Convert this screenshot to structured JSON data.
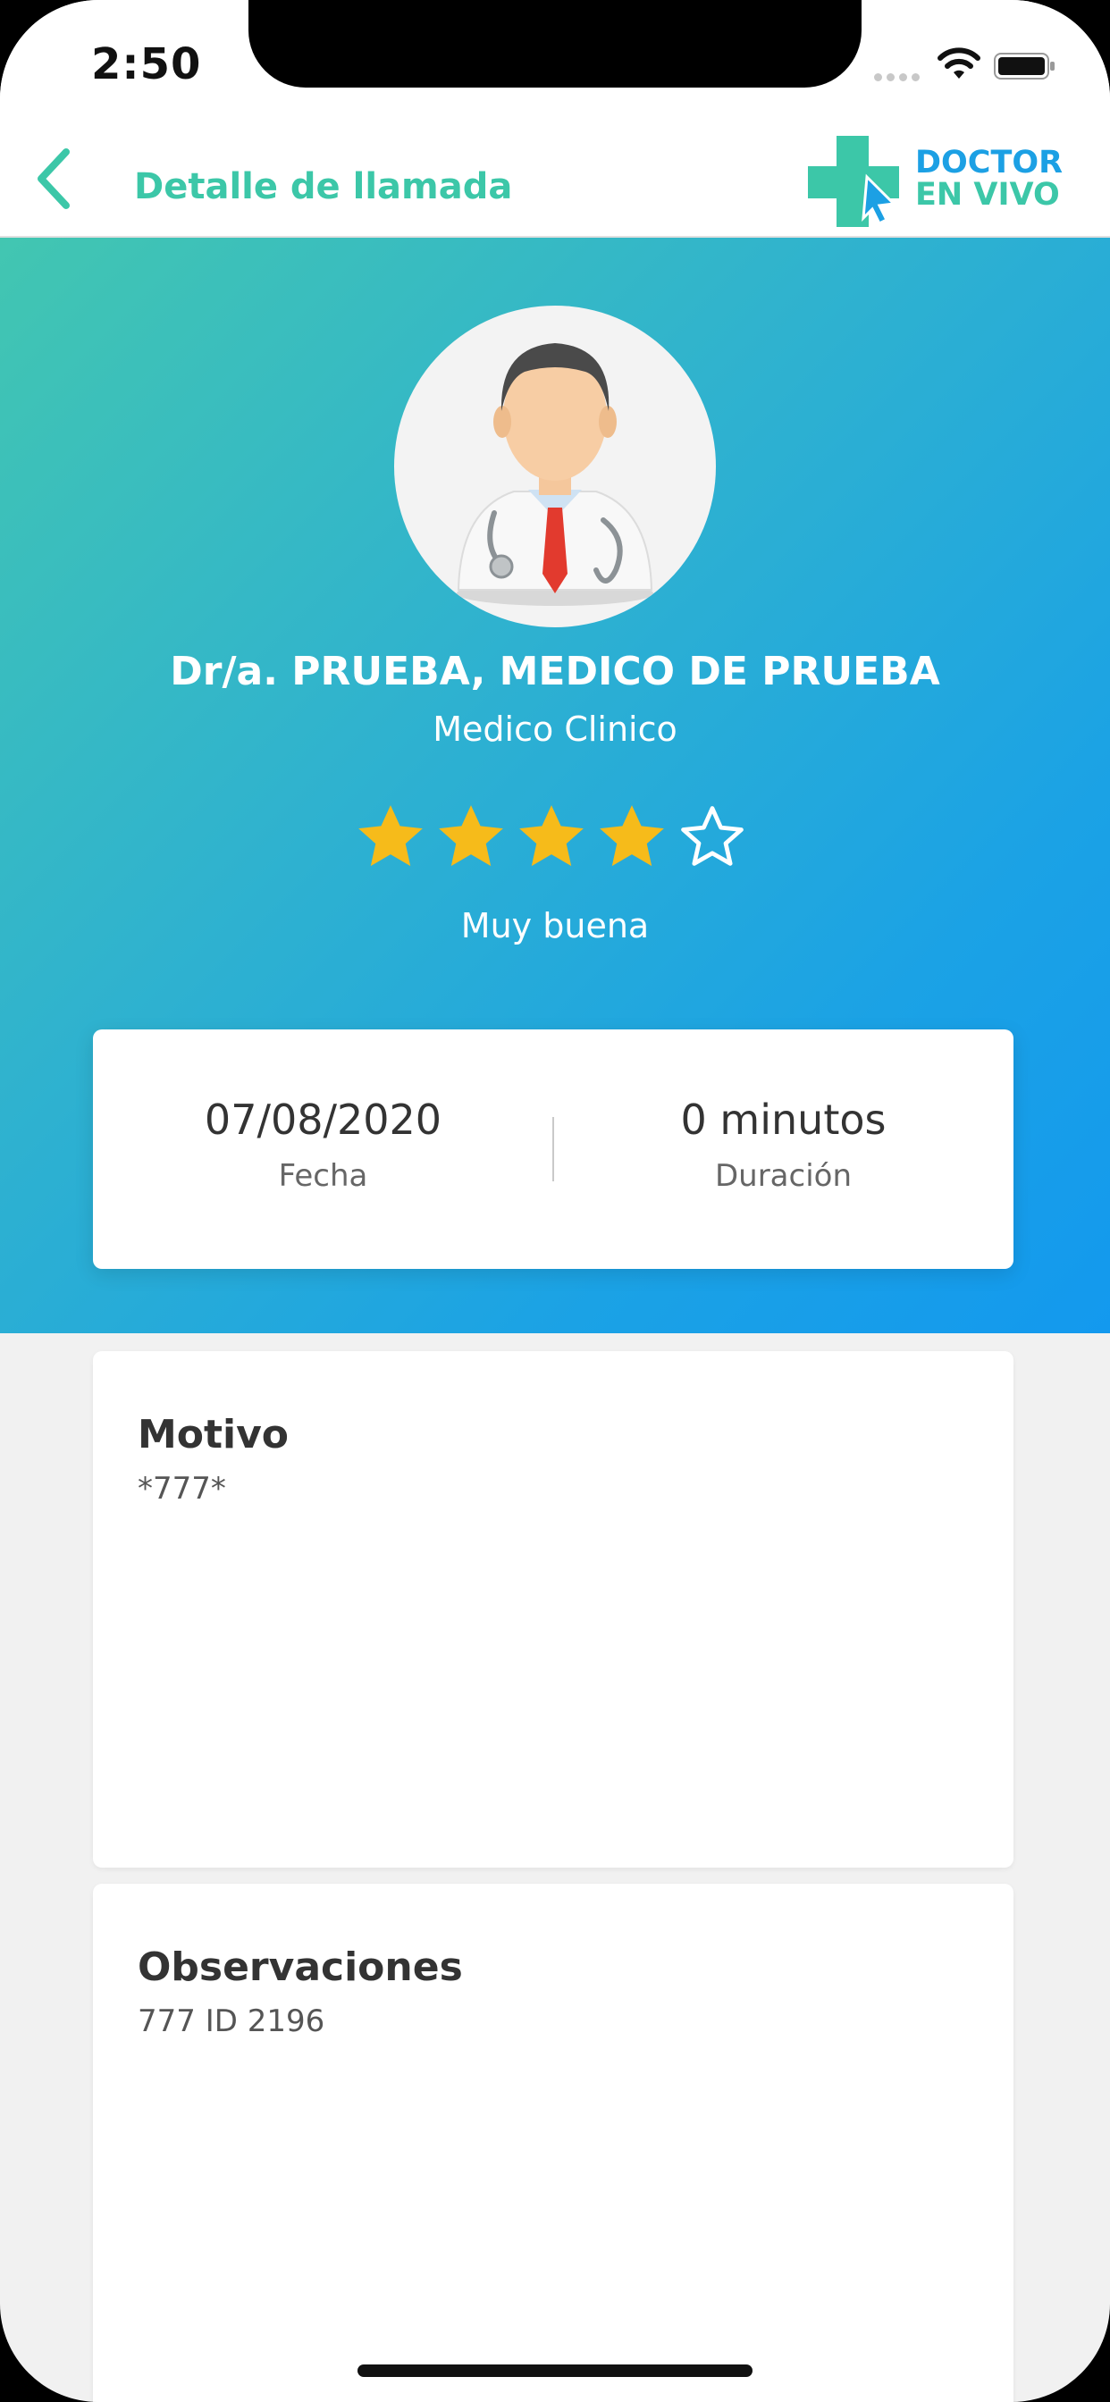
{
  "status_bar": {
    "time": "2:50"
  },
  "nav": {
    "title": "Detalle de llamada",
    "brand_line1": "DOCTOR",
    "brand_line2": "EN VIVO"
  },
  "doctor": {
    "name": "Dr/a. PRUEBA, MEDICO DE PRUEBA",
    "specialty": "Medico Clinico"
  },
  "rating": {
    "value": 4,
    "max": 5,
    "label": "Muy buena"
  },
  "call": {
    "date_value": "07/08/2020",
    "date_label": "Fecha",
    "duration_value": "0 minutos",
    "duration_label": "Duración"
  },
  "motivo": {
    "title": "Motivo",
    "value": "*777*"
  },
  "observaciones": {
    "title": "Observaciones",
    "value": "777 ID 2196"
  },
  "colors": {
    "accent_green": "#3cc7a8",
    "accent_blue": "#1ca0e4",
    "star": "#f6bb1a"
  },
  "icons": {
    "back": "chevron-left-icon",
    "brand": "medical-cross-icon",
    "avatar": "doctor-avatar-icon",
    "star_filled": "star-filled-icon",
    "star_empty": "star-outline-icon"
  }
}
